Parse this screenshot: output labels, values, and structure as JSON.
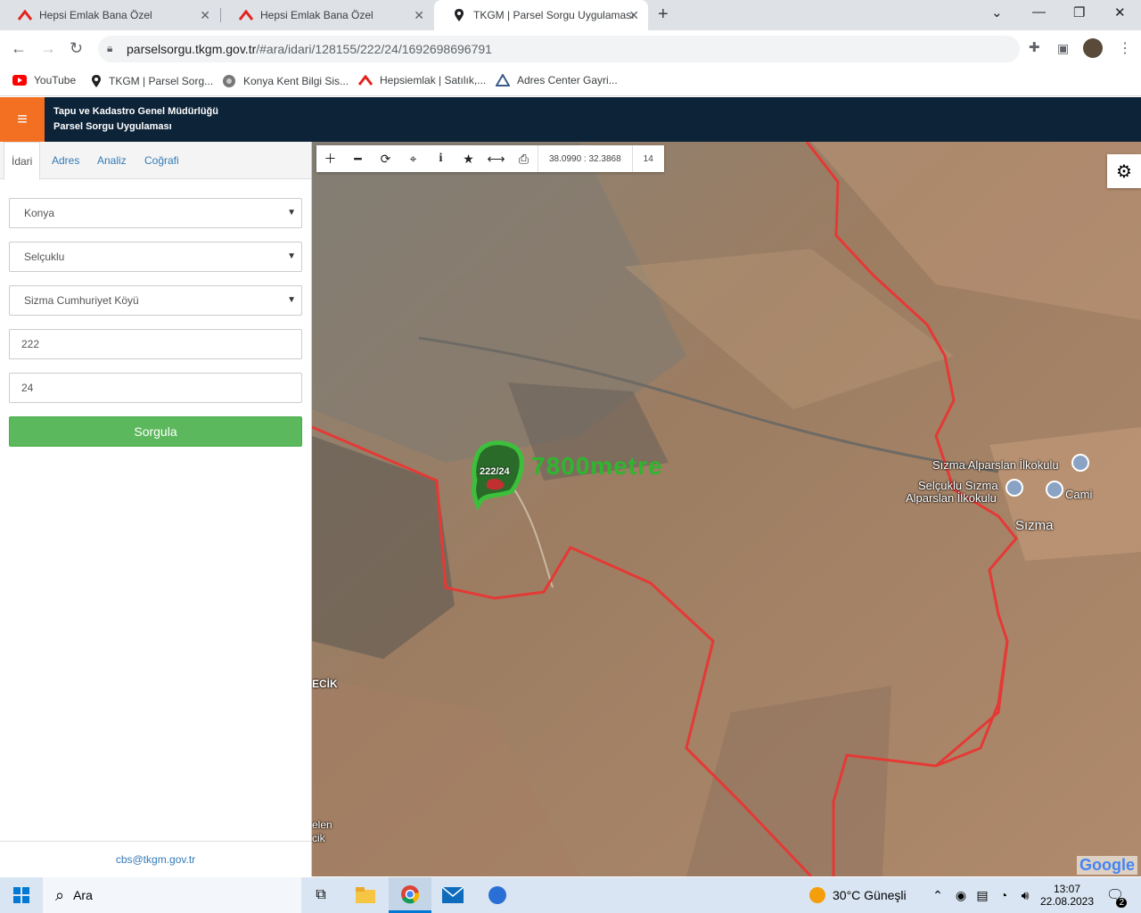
{
  "browser": {
    "tabs": [
      {
        "title": "Hepsi Emlak Bana Özel",
        "icon": "hepsiemlak-icon"
      },
      {
        "title": "Hepsi Emlak Bana Özel",
        "icon": "hepsiemlak-icon"
      },
      {
        "title": "TKGM | Parsel Sorgu Uygulaması",
        "icon": "location-pin-icon"
      }
    ],
    "url_host": "parselsorgu.tkgm.gov.tr",
    "url_path": "/#ara/idari/128155/222/24/1692698696791",
    "bookmarks": [
      {
        "label": "YouTube",
        "icon": "youtube-icon"
      },
      {
        "label": "TKGM | Parsel Sorg...",
        "icon": "location-pin-icon"
      },
      {
        "label": "Konya Kent Bilgi Sis...",
        "icon": "konya-icon"
      },
      {
        "label": "Hepsiemlak | Satılık,...",
        "icon": "hepsiemlak-icon"
      },
      {
        "label": "Adres Center Gayri...",
        "icon": "adres-center-icon"
      }
    ]
  },
  "app": {
    "title_line1": "Tapu ve Kadastro Genel Müdürlüğü",
    "title_line2": "Parsel Sorgu Uygulaması",
    "accent": "#f36f21",
    "header_bg": "#0d2338"
  },
  "sidebar": {
    "tabs": [
      "İdari",
      "Adres",
      "Analiz",
      "Coğrafi"
    ],
    "il": "Konya",
    "ilce": "Selçuklu",
    "mahalle": "Sizma Cumhuriyet Köyü",
    "ada": "222",
    "parsel": "24",
    "submit_label": "Sorgula",
    "footer_email": "cbs@tkgm.gov.tr"
  },
  "map": {
    "coords": "38.0990 : 32.3868",
    "zoom": "14",
    "parcel_label": "222/24",
    "watermark": "7800metre",
    "labels": {
      "school1": "Sızma Alparslan İlkokulu",
      "school2_line1": "Selçuklu Sızma",
      "school2_line2": "Alparslan İlkokulu",
      "cami": "Cami",
      "sizma": "Sızma",
      "ecik": "ECİK",
      "elen1": "elen",
      "elen2": "cik"
    },
    "attribution": "Google",
    "boundary_color": "#e53935"
  },
  "taskbar": {
    "search_placeholder": "Ara",
    "weather": "30°C  Güneşli",
    "time": "13:07",
    "date": "22.08.2023",
    "notifications": "2"
  }
}
